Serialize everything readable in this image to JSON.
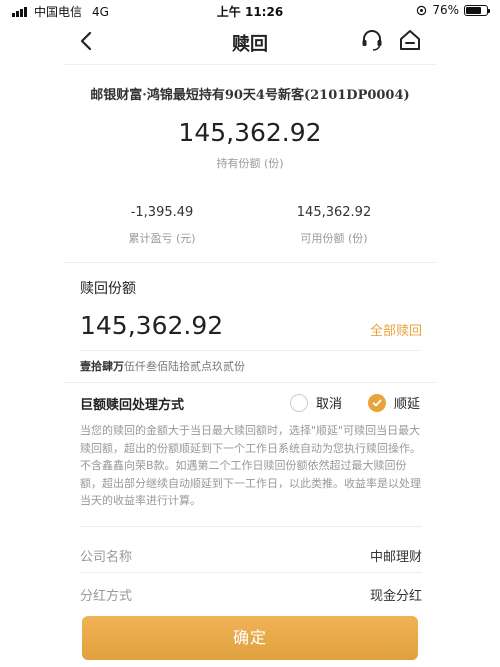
{
  "status_bar": {
    "carrier": "中国电信",
    "network": "4G",
    "time": "上午 11:26",
    "battery_text": "76%",
    "battery_level": 0.76
  },
  "nav": {
    "title": "赎回",
    "icons": [
      "back-arrow-icon",
      "customer-service-icon",
      "home-icon"
    ]
  },
  "product": {
    "name": "邮银财富·鸿锦最短持有90天4号新客(2101DP0004)",
    "holding_value": "145,362.92",
    "holding_label": "持有份额 (份)",
    "profit_value": "-1,395.49",
    "profit_label": "累计盈亏 (元)",
    "available_value": "145,362.92",
    "available_label": "可用份额 (份)"
  },
  "redeem": {
    "section_title": "赎回份额",
    "amount": "145,362.92",
    "all_label": "全部赎回",
    "amount_words_bold": "壹拾肆万",
    "amount_words_rest": "伍仟叁佰陆拾贰点玖贰份"
  },
  "large_redemption": {
    "title": "巨额赎回处理方式",
    "option_cancel": "取消",
    "option_defer": "顺延",
    "selected": "顺延",
    "explanation": "当您的赎回的金额大于当日最大赎回额时，选择\"顺延\"可赎回当日最大赎回额，超出的份额顺延到下一个工作日系统自动为您执行赎回操作。不含鑫鑫向荣B款。如遇第二个工作日赎回份额依然超过最大赎回份额，超出部分继续自动顺延到下一工作日，以此类推。收益率是以处理当天的收益率进行计算。"
  },
  "info": {
    "company_label": "公司名称",
    "company_value": "中邮理财",
    "dividend_label": "分红方式",
    "dividend_value": "现金分红"
  },
  "footer": {
    "confirm_label": "确定"
  },
  "colors": {
    "accent": "#e8a33d",
    "muted_text": "#999999"
  }
}
